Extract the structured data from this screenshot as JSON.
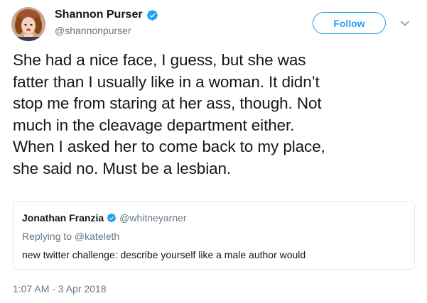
{
  "author": {
    "display_name": "Shannon Purser",
    "handle": "@shannonpurser",
    "verified_icon": "verified-badge-icon",
    "avatar_icon": "avatar"
  },
  "follow_button": {
    "label": "Follow"
  },
  "menu": {
    "icon": "chevron-down-icon"
  },
  "tweet": {
    "lines": [
      "She had a nice face, I guess, but she was",
      "fatter than I usually like in a woman. It didn’t",
      "stop me from staring at her ass, though. Not",
      "much in the cleavage department either.",
      "When I asked her to come back to my place,",
      "she said no. Must be a lesbian."
    ]
  },
  "quoted_tweet": {
    "display_name": "Jonathan Franzia",
    "handle": "@whitneyarner",
    "replying_to": "Replying to @kateleth",
    "text": "new twitter challenge: describe yourself like a male author would"
  },
  "timestamp": "1:07 AM - 3 Apr 2018",
  "colors": {
    "accent": "#1da1f2",
    "text": "#14171a",
    "muted": "#657786",
    "border": "#e1e8ed"
  }
}
